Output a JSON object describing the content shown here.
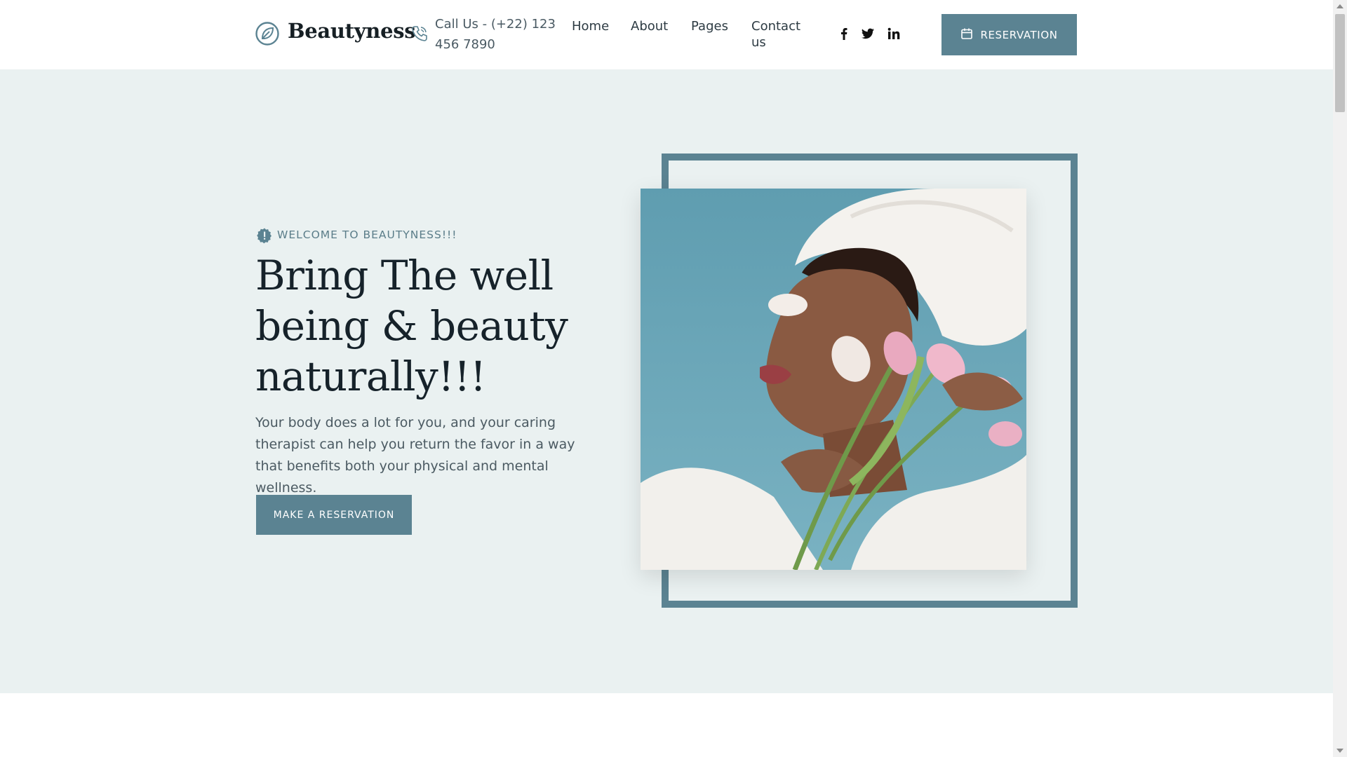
{
  "header": {
    "logo_text": "Beautyness",
    "logo_icon": "leaf-circle-icon",
    "phone_icon": "phone-icon",
    "phone_text": "Call Us - (+22) 123 456 7890",
    "nav": [
      {
        "label": "Home"
      },
      {
        "label": "About"
      },
      {
        "label": "Pages"
      },
      {
        "label": "Contact us"
      }
    ],
    "social": [
      "facebook-icon",
      "twitter-icon",
      "linkedin-icon"
    ],
    "reservation_label": "RESERVATION",
    "reservation_icon": "calendar-icon"
  },
  "hero": {
    "tag": "WELCOME TO BEAUTYNESS!!!",
    "title": "Bring The well being & beauty naturally!!!",
    "description": "Your body does a lot for you, and your caring therapist can help you return the favor in a way that benefits both your physical and mental wellness.",
    "cta_label": "MAKE A RESERVATION",
    "image_alt": "woman-with-towel-and-tulips-photo"
  },
  "colors": {
    "accent": "#5b8392",
    "hero_bg": "#eaf1f1",
    "heading": "#16222a"
  }
}
